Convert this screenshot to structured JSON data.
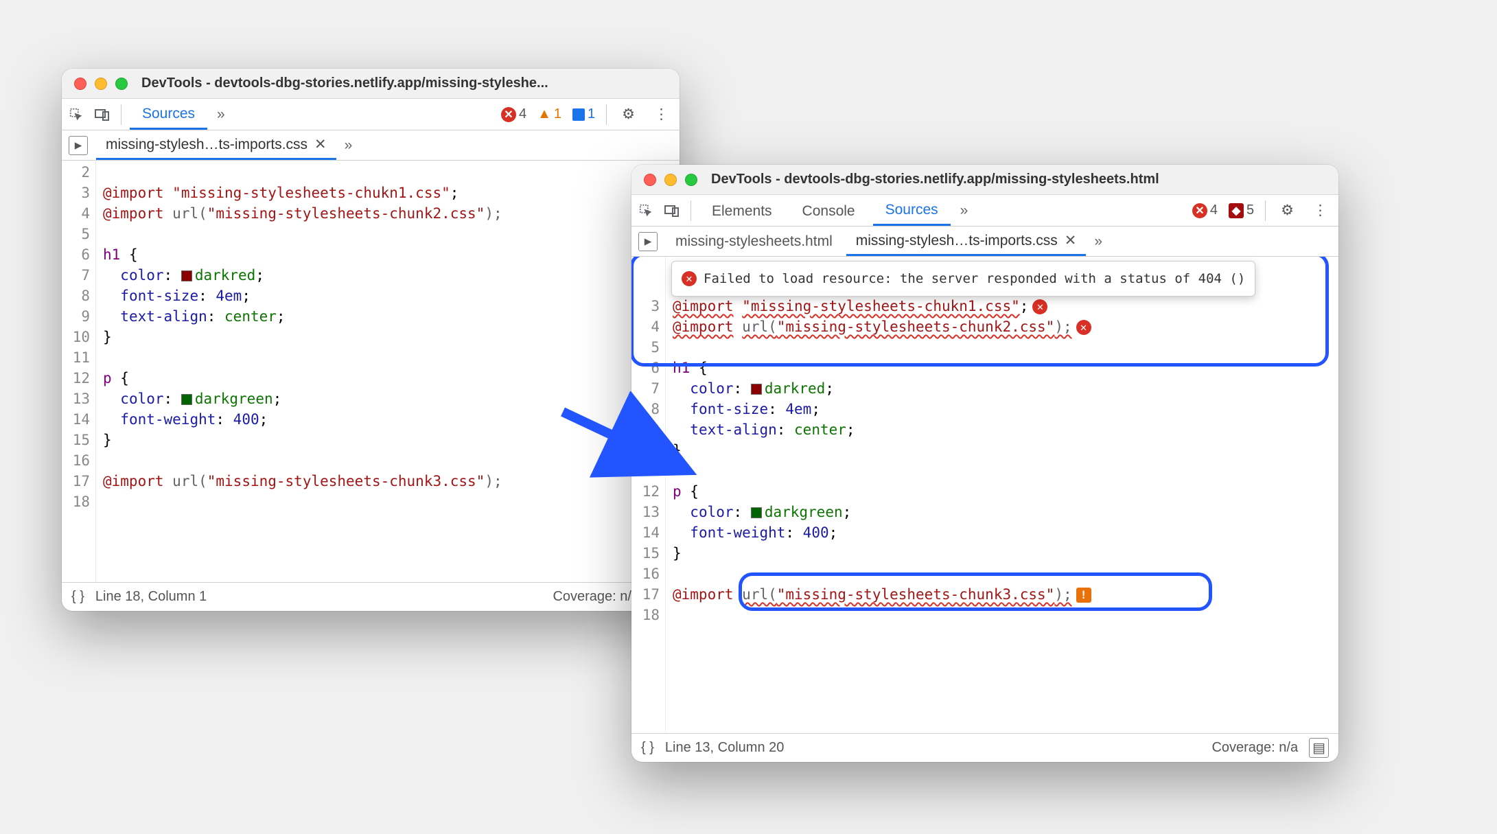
{
  "leftWindow": {
    "title": "DevTools - devtools-dbg-stories.netlify.app/missing-styleshe...",
    "tabs": {
      "active": "Sources",
      "overflow": "»"
    },
    "counts": {
      "errors": "4",
      "warnings": "1",
      "info": "1"
    },
    "fileTab": {
      "name": "missing-stylesh…ts-imports.css",
      "overflow": "»"
    },
    "lines": {
      "2": "",
      "3": {
        "kw": "@import",
        "str": "\"missing-stylesheets-chukn1.css\"",
        "semi": ";"
      },
      "4": {
        "kw": "@import",
        "fn": "url(",
        "str": "\"missing-stylesheets-chunk2.css\"",
        "close": ");"
      },
      "5": "",
      "6": {
        "sel": "h1",
        "brace": " {"
      },
      "7": {
        "prop": "color",
        "val": "darkred",
        "swatch": "#8b0000"
      },
      "8": {
        "prop": "font-size",
        "val": "4em"
      },
      "9": {
        "prop": "text-align",
        "val": "center"
      },
      "10": "}",
      "11": "",
      "12": {
        "sel": "p",
        "brace": " {"
      },
      "13": {
        "prop": "color",
        "val": "darkgreen",
        "swatch": "#006400"
      },
      "14": {
        "prop": "font-weight",
        "val": "400"
      },
      "15": "}",
      "16": "",
      "17": {
        "kw": "@import",
        "fn": "url(",
        "str": "\"missing-stylesheets-chunk3.css\"",
        "close": ");"
      },
      "18": ""
    },
    "status": {
      "pos": "Line 18, Column 1",
      "coverage": "Coverage: n/a"
    }
  },
  "rightWindow": {
    "title": "DevTools - devtools-dbg-stories.netlify.app/missing-stylesheets.html",
    "tabs": {
      "t1": "Elements",
      "t2": "Console",
      "active": "Sources",
      "overflow": "»"
    },
    "counts": {
      "errors": "4",
      "issues": "5"
    },
    "fileTabs": {
      "t1": "missing-stylesheets.html",
      "t2": "missing-stylesh…ts-imports.css",
      "overflow": "»"
    },
    "tooltip": "Failed to load resource: the server responded with a status of 404 ()",
    "lines": {
      "3": {
        "kw": "@import",
        "str": "\"missing-stylesheets-chukn1.css\"",
        "semi": ";"
      },
      "4": {
        "kw": "@import",
        "fn": "url(",
        "str": "\"missing-stylesheets-chunk2.css\"",
        "close": ");"
      },
      "5": "",
      "6": {
        "sel": "h1",
        "brace": " {"
      },
      "7": {
        "prop": "color",
        "val": "darkred",
        "swatch": "#8b0000"
      },
      "8": {
        "prop": "font-size",
        "val": "4em"
      },
      "9": {
        "prop": "text-align",
        "val": "center"
      },
      "10": "}",
      "11": "",
      "12": {
        "sel": "p",
        "brace": " {"
      },
      "13": {
        "prop": "color",
        "val": "darkgreen",
        "swatch": "#006400"
      },
      "14": {
        "prop": "font-weight",
        "val": "400"
      },
      "15": "}",
      "16": "",
      "17": {
        "kw": "@import",
        "fn": "url(",
        "str": "\"missing-stylesheets-chunk3.css\"",
        "close": ");"
      },
      "18": ""
    },
    "status": {
      "pos": "Line 13, Column 20",
      "coverage": "Coverage: n/a"
    }
  },
  "icons": {
    "xmark": "✕",
    "gear": "⚙",
    "kebab": "⋮",
    "chevrons": "»",
    "braces": "{ }",
    "panel": "▶"
  }
}
